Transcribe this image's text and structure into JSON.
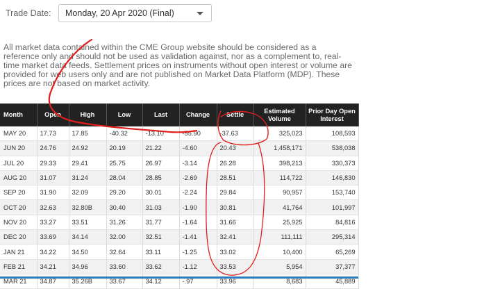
{
  "trade_date": {
    "label": "Trade Date:",
    "value": "Monday, 20 Apr 2020 (Final)"
  },
  "disclaimer": "All market data contained within the CME Group website should be considered as a reference only and should not be used as validation against, nor as a complement to, real-time market data feeds. Settlement prices on instruments without open interest or volume are provided for web users only and are not published on Market Data Platform (MDP). These prices are not based on market activity.",
  "table": {
    "columns": [
      "Month",
      "Open",
      "High",
      "Low",
      "Last",
      "Change",
      "Settle",
      "Estimated Volume",
      "Prior Day Open Interest"
    ],
    "rows": [
      [
        "MAY 20",
        "17.73",
        "17.85",
        "-40.32",
        "-13.10",
        "-55.90",
        "-37.63",
        "325,023",
        "108,593"
      ],
      [
        "JUN 20",
        "24.76",
        "24.92",
        "20.19",
        "21.22",
        "-4.60",
        "20.43",
        "1,458,171",
        "538,038"
      ],
      [
        "JUL 20",
        "29.33",
        "29.41",
        "25.75",
        "26.97",
        "-3.14",
        "26.28",
        "398,213",
        "330,373"
      ],
      [
        "AUG 20",
        "31.07",
        "31.24",
        "28.04",
        "28.85",
        "-2.69",
        "28.51",
        "114,722",
        "146,830"
      ],
      [
        "SEP 20",
        "31.90",
        "32.09",
        "29.20",
        "30.01",
        "-2.24",
        "29.84",
        "90,957",
        "153,740"
      ],
      [
        "OCT 20",
        "32.63",
        "32.80B",
        "30.40",
        "31.03",
        "-1.90",
        "30.81",
        "41,764",
        "101,997"
      ],
      [
        "NOV 20",
        "33.27",
        "33.51",
        "31.26",
        "31.77",
        "-1.64",
        "31.66",
        "25,925",
        "84,816"
      ],
      [
        "DEC 20",
        "33.69",
        "34.14",
        "32.00",
        "32.51",
        "-1.41",
        "32.41",
        "111,111",
        "295,314"
      ],
      [
        "JAN 21",
        "34.22",
        "34.50",
        "32.64",
        "33.11",
        "-1.25",
        "33.02",
        "10,400",
        "65,269"
      ],
      [
        "FEB 21",
        "34.21",
        "34.96",
        "33.60",
        "33.62",
        "-1.12",
        "33.53",
        "5,954",
        "37,377"
      ],
      [
        "MAR 21",
        "34.87",
        "35.26B",
        "33.67",
        "34.12",
        "-.97",
        "33.96",
        "8,683",
        "45,889"
      ]
    ]
  },
  "colors": {
    "header_bg": "#222222",
    "annotation": "#e01e1e",
    "accent_bar": "#2c7bbf"
  },
  "icons": {
    "dropdown": "caret-down-icon"
  }
}
